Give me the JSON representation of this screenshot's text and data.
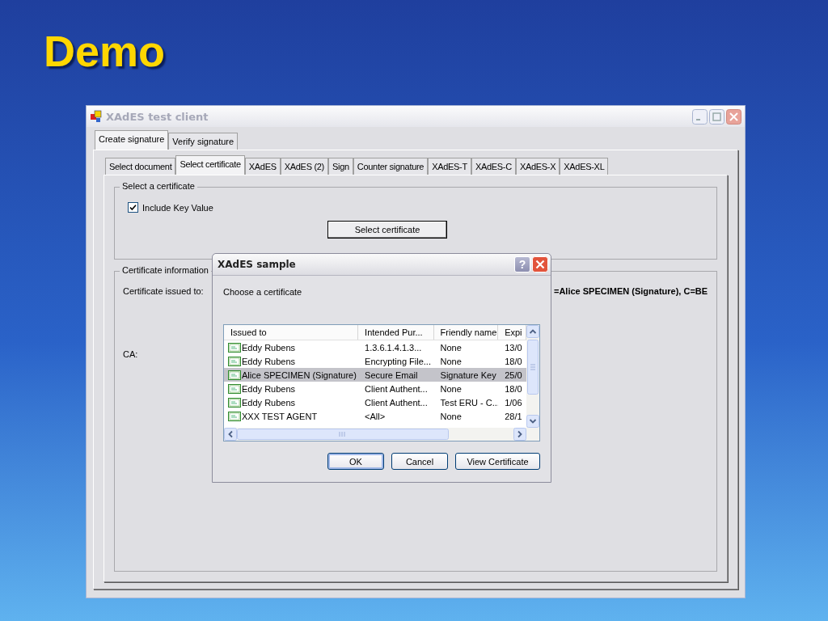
{
  "slide": {
    "title": "Demo"
  },
  "window": {
    "title": "XAdES test client"
  },
  "tabs": [
    {
      "label": "Create signature",
      "selected": true
    },
    {
      "label": "Verify signature",
      "selected": false
    }
  ],
  "subtabs": [
    {
      "label": "Select document",
      "selected": false
    },
    {
      "label": "Select certificate",
      "selected": true
    },
    {
      "label": "XAdES",
      "selected": false
    },
    {
      "label": "XAdES (2)",
      "selected": false
    },
    {
      "label": "Sign",
      "selected": false
    },
    {
      "label": "Counter signature",
      "selected": false
    },
    {
      "label": "XAdES-T",
      "selected": false
    },
    {
      "label": "XAdES-C",
      "selected": false
    },
    {
      "label": "XAdES-X",
      "selected": false
    },
    {
      "label": "XAdES-XL",
      "selected": false
    }
  ],
  "select_group": {
    "legend": "Select a certificate",
    "include_key_value": {
      "label": "Include Key Value",
      "checked": true
    },
    "button": "Select certificate"
  },
  "info_group": {
    "legend": "Certificate information",
    "fields": [
      {
        "label": "Certificate issued to:",
        "value": "=Alice SPECIMEN (Signature), C=BE"
      },
      {
        "label": "CA:"
      }
    ]
  },
  "dialog": {
    "title": "XAdES sample",
    "help_button": "?",
    "prompt": "Choose a certificate",
    "columns": [
      "Issued to",
      "Intended Pur...",
      "Friendly name",
      "Expi"
    ],
    "rows": [
      {
        "cells": [
          "Eddy Rubens",
          "1.3.6.1.4.1.3...",
          "None",
          "13/0"
        ],
        "selected": false
      },
      {
        "cells": [
          "Eddy Rubens",
          "Encrypting File...",
          "None",
          "18/0"
        ],
        "selected": false
      },
      {
        "cells": [
          "Alice SPECIMEN (Signature)",
          "Secure Email",
          "Signature Key",
          "25/0"
        ],
        "selected": true
      },
      {
        "cells": [
          "Eddy Rubens",
          "Client Authent...",
          "None",
          "18/0"
        ],
        "selected": false
      },
      {
        "cells": [
          "Eddy Rubens",
          "Client Authent...",
          "Test ERU - C...",
          "1/06"
        ],
        "selected": false
      },
      {
        "cells": [
          "XXX TEST AGENT",
          "<All>",
          "None",
          "28/1"
        ],
        "selected": false
      }
    ],
    "buttons": [
      {
        "label": "OK",
        "default": true
      },
      {
        "label": "Cancel",
        "default": false
      },
      {
        "label": "View Certificate",
        "default": false
      }
    ]
  }
}
